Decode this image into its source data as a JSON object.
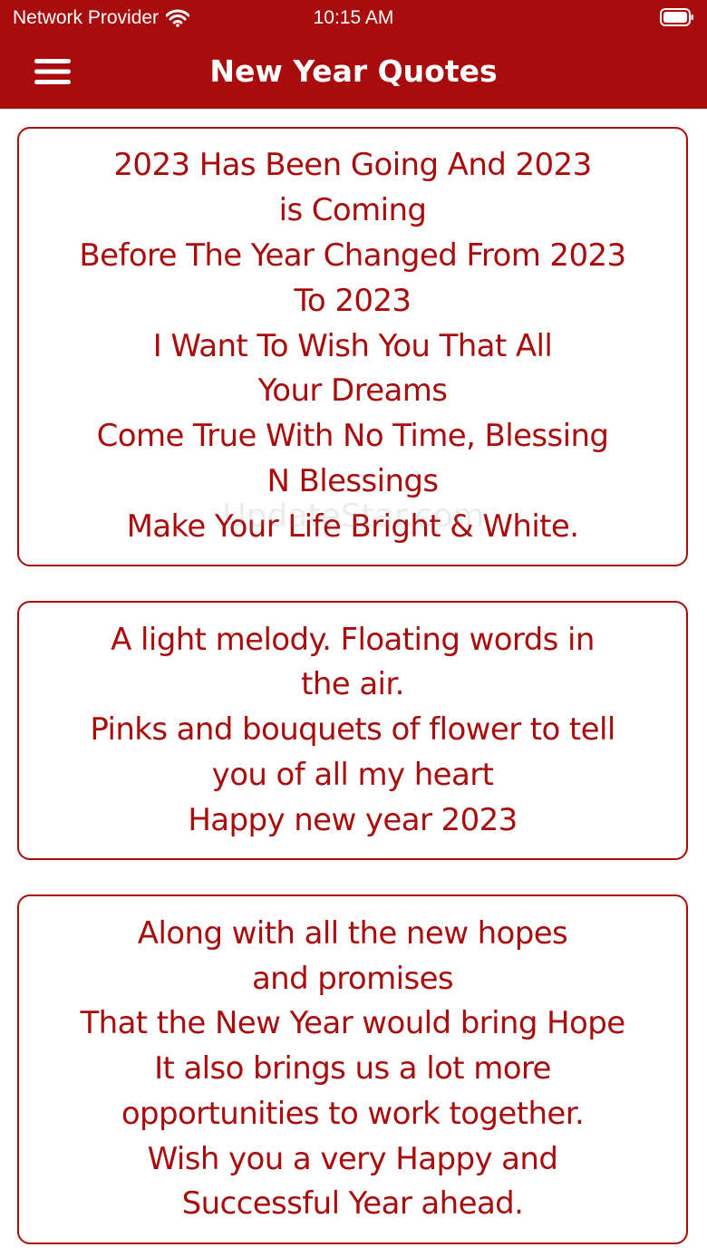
{
  "status_bar": {
    "carrier": "Network Provider",
    "time": "10:15 AM",
    "wifi_icon": "wifi-icon",
    "battery_icon": "battery-icon"
  },
  "nav": {
    "menu_icon": "hamburger-menu-icon",
    "title": "New Year Quotes"
  },
  "quotes": [
    {
      "text": "2023 Has Been Going And 2023\nis Coming\nBefore The Year Changed From 2023\nTo 2023\nI Want To Wish You That All\nYour Dreams\nCome True With No Time, Blessing\nN Blessings\nMake Your Life Bright & White."
    },
    {
      "text": "A light melody. Floating words in\nthe air.\nPinks and bouquets of flower to tell\nyou of all my heart\nHappy new year 2023"
    },
    {
      "text": "Along with all the new hopes\nand promises\nThat the New Year would bring Hope\nIt also brings us a lot more\nopportunities to work together.\nWish you a very Happy and\nSuccessful Year ahead."
    }
  ],
  "watermark": "UpdateStar.com",
  "colors": {
    "primary": "#a80c0c",
    "background": "#ffffff",
    "on_primary": "#ffffff"
  }
}
